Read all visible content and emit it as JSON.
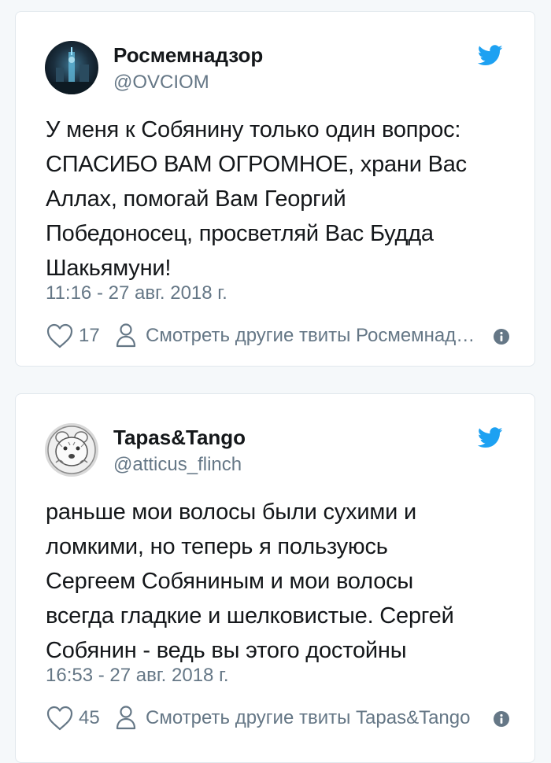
{
  "tweets": [
    {
      "display_name": "Росмемнадзор",
      "handle": "@OVCIOM",
      "text_lines": [
        "У меня к Собянину только один вопрос:",
        "СПАСИБО ВАМ ОГРОМНОЕ, храни Вас",
        "Аллах, помогай Вам Георгий",
        "Победоносец, просветляй Вас Будда",
        "Шакьямуни!"
      ],
      "timestamp": "11:16 - 27 авг. 2018 г.",
      "likes": "17",
      "more_link": "Смотреть другие твиты Росмемнадзор"
    },
    {
      "display_name": "Tapas&Tango",
      "handle": "@atticus_flinch",
      "text_lines": [
        "раньше мои волосы были сухими и",
        "ломкими, но теперь я пользуюсь",
        "Сергеем Собяниным и мои волосы",
        "всегда гладкие и шелковистые.  Сергей",
        "Собянин - ведь вы этого достойны"
      ],
      "timestamp": "16:53 - 27 авг. 2018 г.",
      "likes": "45",
      "more_link": "Смотреть другие твиты Tapas&Tango"
    }
  ],
  "icons": {
    "brand": "twitter-bird-icon",
    "like": "heart-icon",
    "profile": "person-icon",
    "info": "info-icon"
  },
  "colors": {
    "twitter_blue": "#1da1f2",
    "text_primary": "#14171a",
    "text_secondary": "#657786",
    "card_border": "#e1e8ed",
    "background": "#f5f8fa"
  }
}
